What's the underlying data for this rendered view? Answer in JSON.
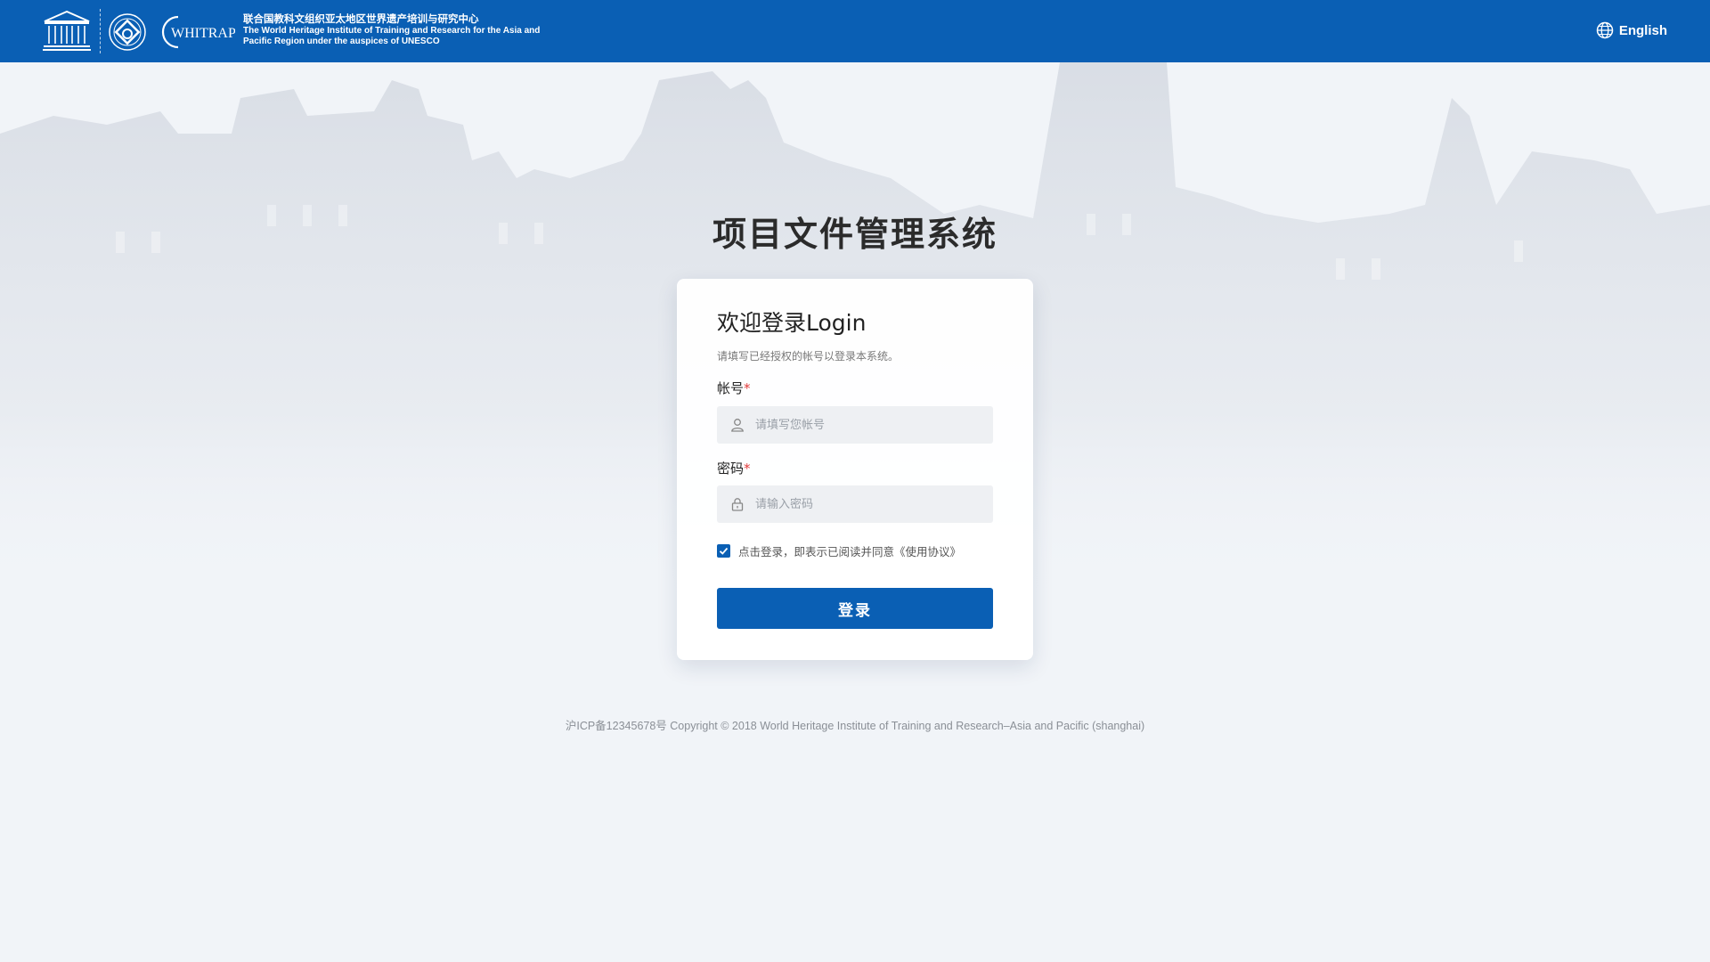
{
  "header": {
    "org_cn": "联合国教科文组织亚太地区世界遗产培训与研究中心",
    "org_en": "The World Heritage Institute of Training and Research for the Asia and Pacific Region under the auspices of UNESCO",
    "logos": {
      "unesco": "UNESCO",
      "whitrap": "WHITRAP"
    },
    "language_label": "English",
    "language_icon": "globe-icon",
    "bg_color": "#0a5fb4"
  },
  "main": {
    "system_title": "项目文件管理系统"
  },
  "login": {
    "title": "欢迎登录Login",
    "subtitle": "请填写已经授权的帐号以登录本系统。",
    "account_label": "帐号",
    "account_placeholder": "请填写您帐号",
    "account_value": "",
    "account_icon": "user-icon",
    "password_label": "密码",
    "password_placeholder": "请输入密码",
    "password_value": "",
    "password_icon": "lock-icon",
    "required_mark": "*",
    "agreement_checked": true,
    "agreement_text": "点击登录，即表示已阅读并同意《使用协议》",
    "submit_label": "登录",
    "accent_color": "#0a5fb4"
  },
  "footer": {
    "text": "沪ICP备12345678号 Copyright © 2018 World Heritage Institute of Training and Research–Asia and Pacific (shanghai)"
  }
}
